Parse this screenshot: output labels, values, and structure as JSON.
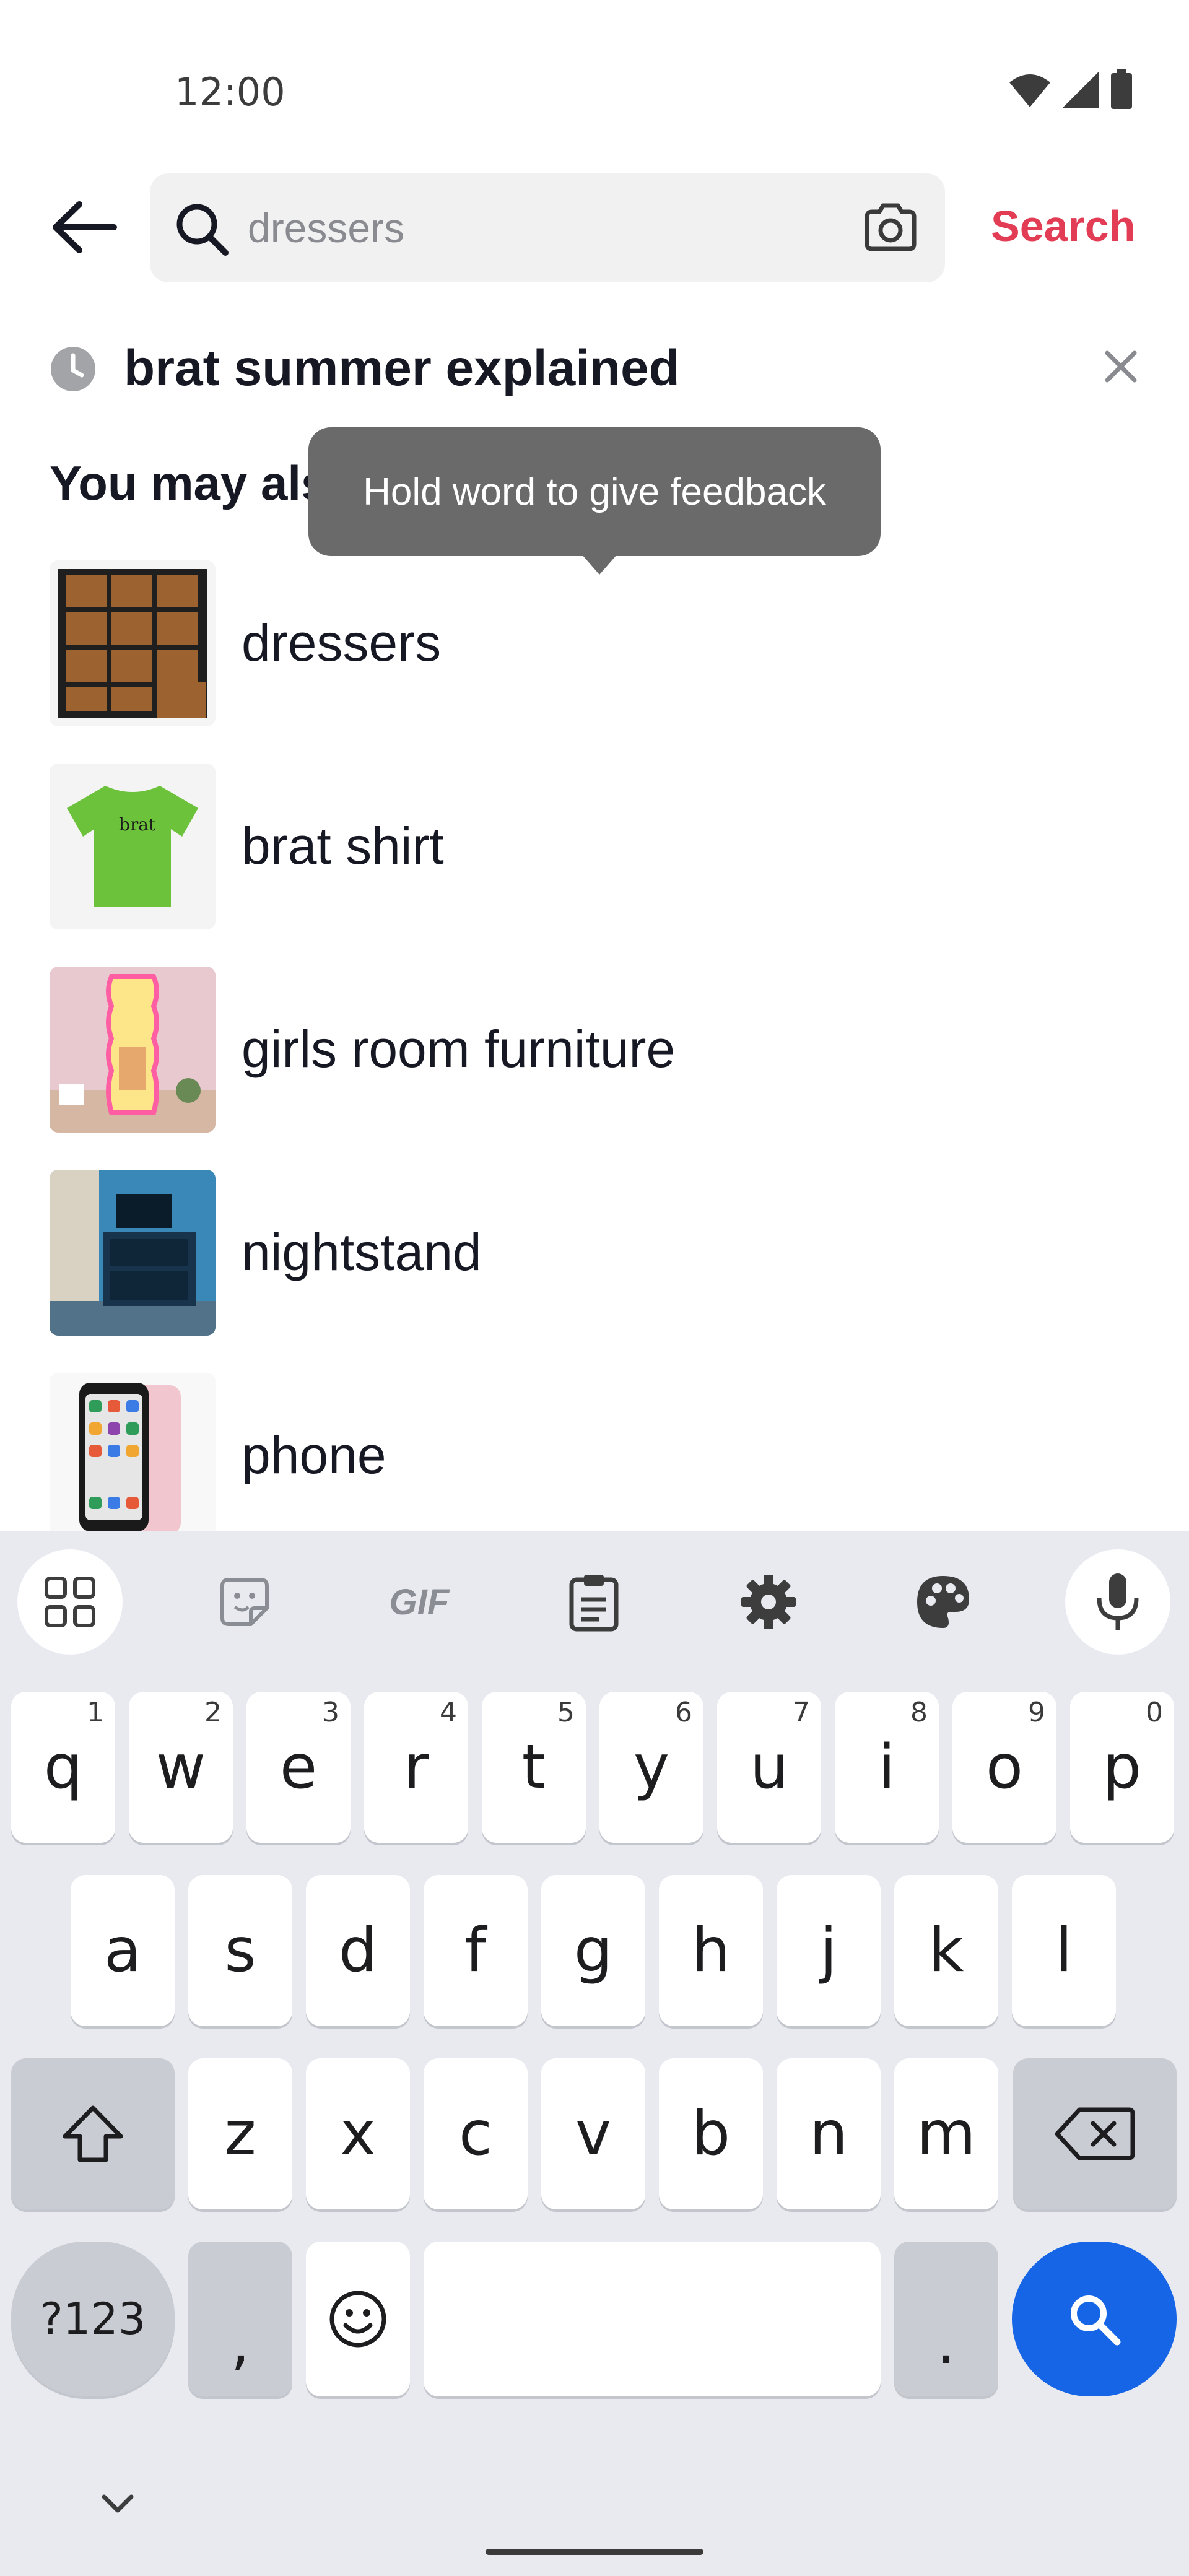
{
  "status_bar": {
    "time": "12:00",
    "icons": [
      "wifi-icon",
      "signal-icon",
      "battery-icon"
    ]
  },
  "search": {
    "placeholder": "dressers",
    "value": "",
    "action_label": "Search"
  },
  "history": {
    "query": "brat summer explained"
  },
  "suggestions": {
    "section_title": "You may also like",
    "items": [
      {
        "label": "dressers",
        "thumb": "dresser-image"
      },
      {
        "label": "brat shirt",
        "thumb": "green-shirt-image",
        "thumb_text": "brat"
      },
      {
        "label": "girls room furniture",
        "thumb": "neon-mirror-image"
      },
      {
        "label": "nightstand",
        "thumb": "nightstand-image"
      },
      {
        "label": "phone",
        "thumb": "phone-image"
      }
    ]
  },
  "tooltip": {
    "text": "Hold word to give feedback"
  },
  "keyboard": {
    "toolbar": [
      "apps-grid-icon",
      "sticker-icon",
      "GIF",
      "clipboard-icon",
      "settings-icon",
      "palette-icon",
      "microphone-icon"
    ],
    "row1": [
      {
        "key": "q",
        "hint": "1"
      },
      {
        "key": "w",
        "hint": "2"
      },
      {
        "key": "e",
        "hint": "3"
      },
      {
        "key": "r",
        "hint": "4"
      },
      {
        "key": "t",
        "hint": "5"
      },
      {
        "key": "y",
        "hint": "6"
      },
      {
        "key": "u",
        "hint": "7"
      },
      {
        "key": "i",
        "hint": "8"
      },
      {
        "key": "o",
        "hint": "9"
      },
      {
        "key": "p",
        "hint": "0"
      }
    ],
    "row2": [
      "a",
      "s",
      "d",
      "f",
      "g",
      "h",
      "j",
      "k",
      "l"
    ],
    "row3": [
      "z",
      "x",
      "c",
      "v",
      "b",
      "n",
      "m"
    ],
    "symbols_label": "?123",
    "comma": ",",
    "period": ".",
    "accent_color": "#1565e6"
  },
  "colors": {
    "brand_red": "#e23d55",
    "text": "#161823",
    "keyboard_bg": "#e8eaf0"
  }
}
